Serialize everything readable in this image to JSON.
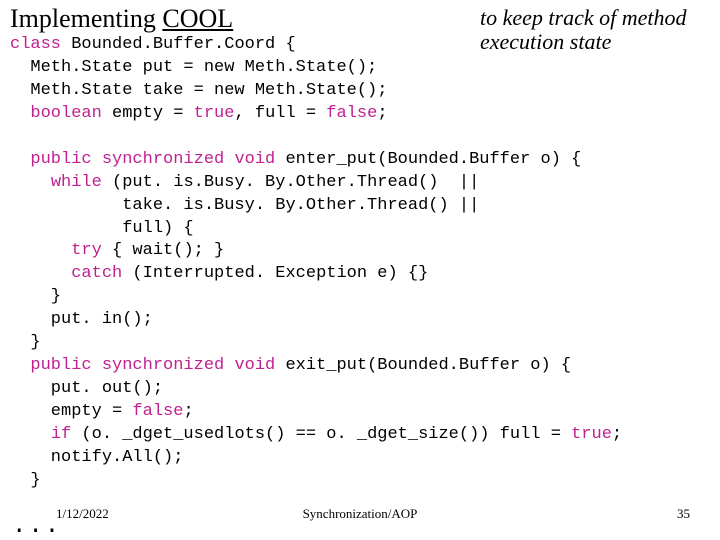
{
  "title": {
    "pre": "Implementing ",
    "cool": "COOL"
  },
  "annotation": "to keep track of method execution state",
  "code": {
    "l1a": "class",
    "l1b": " Bounded.Buffer.Coord {",
    "l2": "  Meth.State put = new Meth.State();",
    "l3": "  Meth.State take = new Meth.State();",
    "l4a": "  ",
    "l4b": "boolean",
    "l4c": " empty = ",
    "l4d": "true",
    "l4e": ", full = ",
    "l4f": "false",
    "l4g": ";",
    "l6a": "  ",
    "l6b": "public synchronized void",
    "l6c": " enter_put(Bounded.Buffer o) {",
    "l7a": "    ",
    "l7b": "while",
    "l7c": " (put. is.Busy. By.Other.Thread()  ||",
    "l8": "           take. is.Busy. By.Other.Thread() ||",
    "l9": "           full) {",
    "l10a": "      ",
    "l10b": "try",
    "l10c": " { wait(); }",
    "l11a": "      ",
    "l11b": "catch",
    "l11c": " (Interrupted. Exception e) {}",
    "l12": "    }",
    "l13": "    put. in();",
    "l14": "  }",
    "l15a": "  ",
    "l15b": "public synchronized void",
    "l15c": " exit_put(Bounded.Buffer o) {",
    "l16": "    put. out();",
    "l17a": "    empty = ",
    "l17b": "false",
    "l17c": ";",
    "l18a": "    ",
    "l18b": "if",
    "l18c": " (o. _dget_usedlots() == o. _dget_size()) full = ",
    "l18d": "true",
    "l18e": ";",
    "l19": "    notify.All();",
    "l20": "  }"
  },
  "dots": "...",
  "footer": {
    "date": "1/12/2022",
    "center": "Synchronization/AOP",
    "page": "35"
  }
}
